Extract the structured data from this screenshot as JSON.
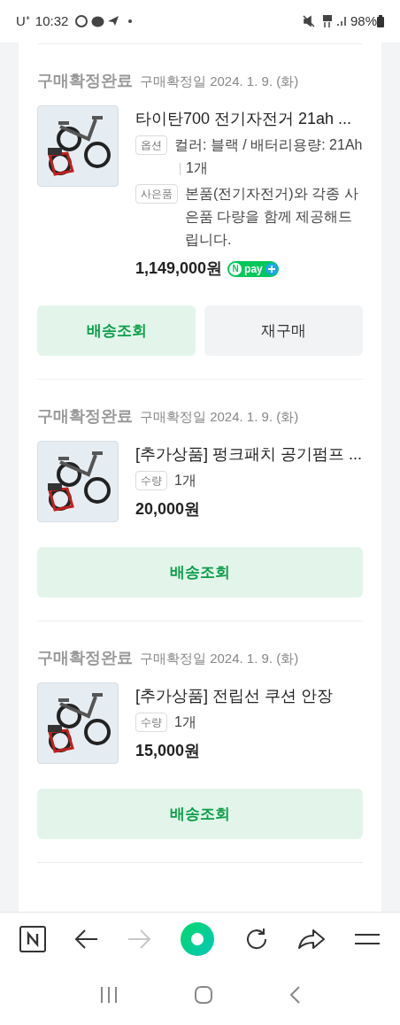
{
  "status_bar": {
    "carrier": "U⁺",
    "time": "10:32",
    "battery": "98%"
  },
  "orders": [
    {
      "status": "구매확정완료",
      "date": "구매확정일 2024. 1. 9. (화)",
      "title": "타이탄700 전기자전거 21ah ...",
      "details": [
        {
          "label": "옵션",
          "text": "컬러: 블랙 / 배터리용량: 21Ah",
          "quantity": "1개"
        },
        {
          "label": "사은품",
          "text": "본품(전기자전거)와 각종 사은품 다량을 함께 제공해드립니다."
        }
      ],
      "price": "1,149,000원",
      "pay_badge": {
        "letter": "N",
        "text": "pay"
      },
      "buttons": [
        {
          "label": "배송조회",
          "kind": "primary"
        },
        {
          "label": "재구매",
          "kind": "secondary"
        }
      ]
    },
    {
      "status": "구매확정완료",
      "date": "구매확정일 2024. 1. 9. (화)",
      "title": "[추가상품] 펑크패치 공기펌프 ...",
      "details": [
        {
          "label": "수량",
          "text": "1개"
        }
      ],
      "price": "20,000원",
      "buttons": [
        {
          "label": "배송조회",
          "kind": "primary"
        }
      ]
    },
    {
      "status": "구매확정완료",
      "date": "구매확정일 2024. 1. 9. (화)",
      "title": "[추가상품] 전립선 쿠션 안장",
      "details": [
        {
          "label": "수량",
          "text": "1개"
        }
      ],
      "price": "15,000원",
      "buttons": [
        {
          "label": "배송조회",
          "kind": "primary"
        }
      ]
    }
  ],
  "browser_bar": {
    "forward_disabled": true
  }
}
